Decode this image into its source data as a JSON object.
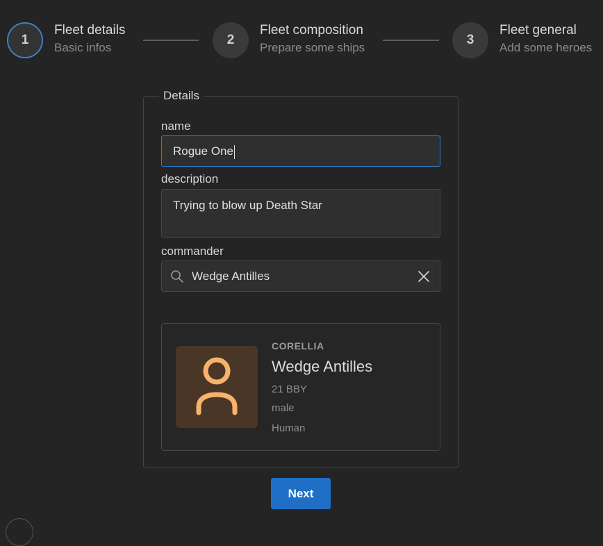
{
  "stepper": {
    "steps": [
      {
        "number": "1",
        "title": "Fleet details",
        "subtitle": "Basic infos",
        "state": "active"
      },
      {
        "number": "2",
        "title": "Fleet composition",
        "subtitle": "Prepare some ships",
        "state": "pending"
      },
      {
        "number": "3",
        "title": "Fleet general",
        "subtitle": "Add some heroes",
        "state": "pending"
      }
    ]
  },
  "form": {
    "legend": "Details",
    "name": {
      "label": "name",
      "value": "Rogue One"
    },
    "description": {
      "label": "description",
      "value": "Trying to blow up Death Star"
    },
    "commander": {
      "label": "commander",
      "value": "Wedge Antilles",
      "search_icon": "search-icon",
      "clear_icon": "close-icon"
    }
  },
  "commander_card": {
    "planet": "CORELLIA",
    "name": "Wedge Antilles",
    "birth_year": "21 BBY",
    "gender": "male",
    "species": "Human",
    "avatar_icon": "person-icon",
    "avatar_bg": "#4a3626",
    "avatar_fg": "#f7b36b"
  },
  "actions": {
    "next_label": "Next"
  },
  "colors": {
    "accent": "#1f6fc6",
    "focus": "#2f7fd1",
    "background": "#242424"
  }
}
